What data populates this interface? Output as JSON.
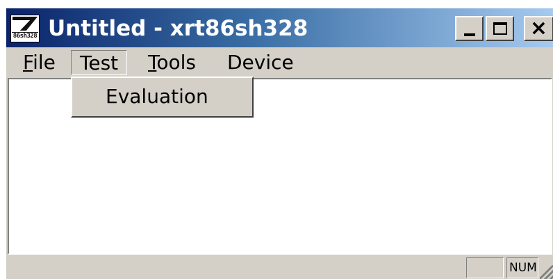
{
  "window": {
    "title": "Untitled - xrt86sh328",
    "icon_name": "app-logo-icon",
    "icon_text": "86sh328",
    "caption_buttons": {
      "minimize": "minimize-icon",
      "maximize": "maximize-icon",
      "close_glyph": "×"
    }
  },
  "menubar": {
    "items": [
      {
        "first": "F",
        "rest": "ile"
      },
      {
        "label": "Test"
      },
      {
        "first": "T",
        "rest": "ools"
      },
      {
        "label": "Device"
      }
    ]
  },
  "dropdown": {
    "items": [
      {
        "label": "Evaluation"
      }
    ]
  },
  "statusbar": {
    "panes": [
      "",
      "NUM"
    ]
  },
  "colors": {
    "titlebar_start": "#0a246a",
    "titlebar_end": "#a6caf0",
    "face": "#d4d0c8",
    "client": "#ffffff"
  }
}
